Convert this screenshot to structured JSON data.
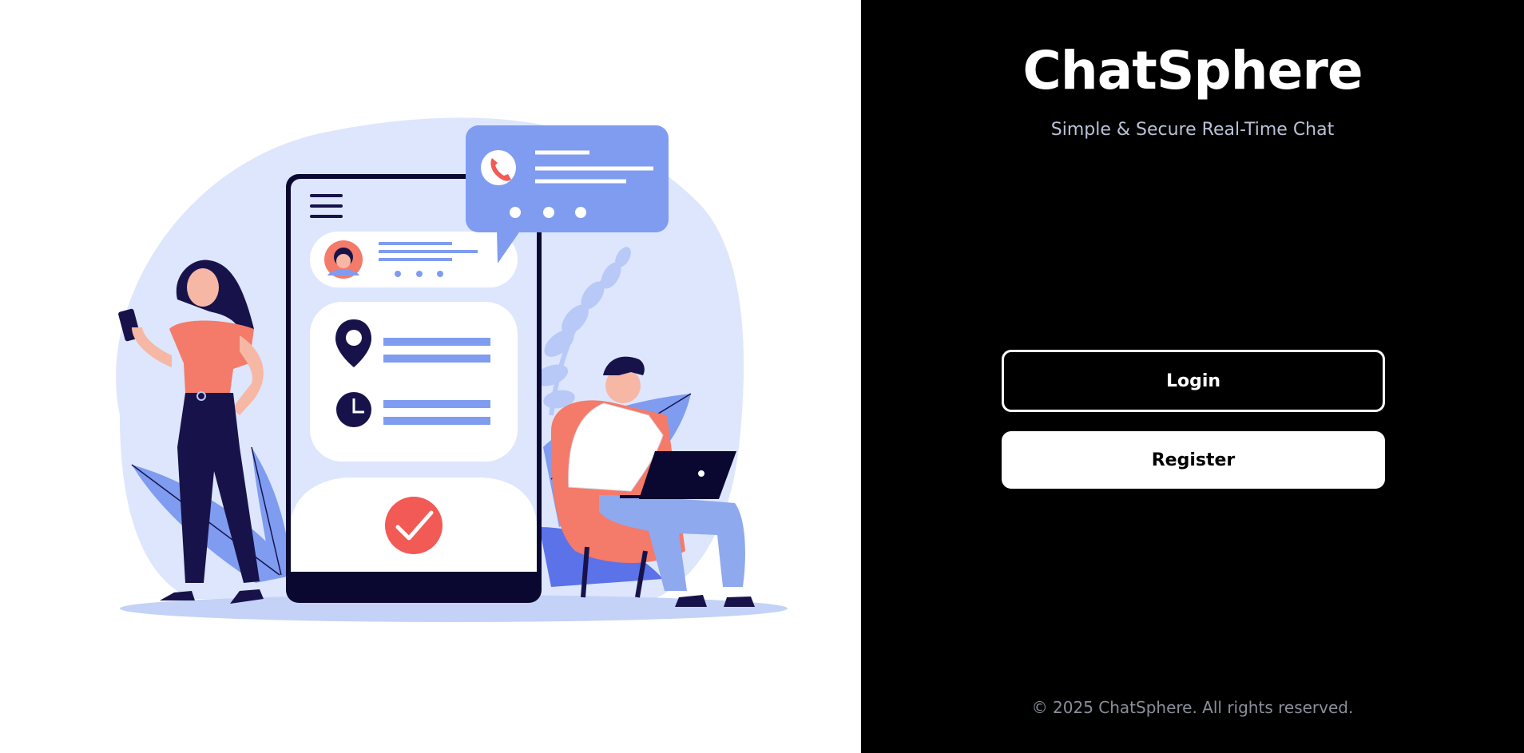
{
  "brand": {
    "title": "ChatSphere",
    "subtitle": "Simple & Secure Real-Time Chat"
  },
  "actions": {
    "login_label": "Login",
    "register_label": "Register"
  },
  "footer": {
    "copyright": "© 2025 ChatSphere. All rights reserved."
  },
  "illustration": {
    "icons": [
      "phone-icon",
      "location-pin-icon",
      "clock-icon",
      "checkmark-icon",
      "menu-icon"
    ]
  },
  "colors": {
    "left_bg": "#ffffff",
    "right_bg": "#000000",
    "accent_blue": "#7f9cf0",
    "accent_coral": "#f47a6a",
    "navy": "#17134a",
    "blob": "#dde6fc"
  }
}
